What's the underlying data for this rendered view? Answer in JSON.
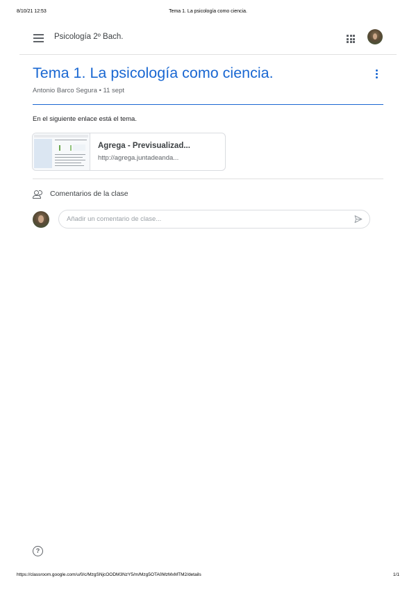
{
  "print_header": {
    "datetime": "8/10/21 12:53",
    "doc_title": "Tema 1. La psicología como ciencia."
  },
  "appbar": {
    "course_name": "Psicología 2º Bach.",
    "menu_icon": "hamburger-menu-icon",
    "apps_icon": "google-apps-grid-icon"
  },
  "post": {
    "title": "Tema 1. La psicología como ciencia.",
    "meta": "Antonio Barco Segura • 11 sept",
    "body": "En el siguiente enlace está el tema.",
    "more_icon": "more-vert-icon",
    "accent_color": "#1967d2"
  },
  "attachment": {
    "title": "Agrega - Previsualizad...",
    "url": "http://agrega.juntadeanda..."
  },
  "comments": {
    "label": "Comentarios de la clase",
    "placeholder": "Añadir un comentario de clase...",
    "send_icon": "send-icon"
  },
  "print_footer": {
    "url": "https://classroom.google.com/u/0/c/MzgSNjcOODM3NzY5/m/Mzg5OTA0MzMxMTM2/details",
    "page": "1/1"
  }
}
